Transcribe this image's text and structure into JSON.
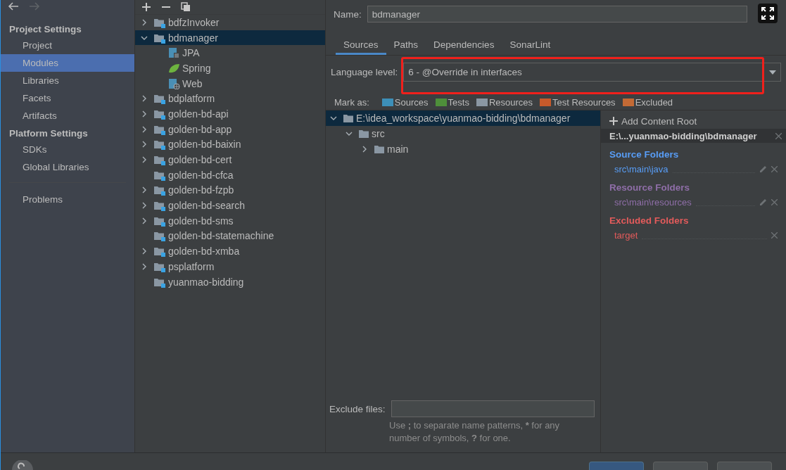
{
  "sidebar": {
    "groups": [
      {
        "title": "Project Settings",
        "items": [
          {
            "label": "Project",
            "selected": false
          },
          {
            "label": "Modules",
            "selected": true
          },
          {
            "label": "Libraries",
            "selected": false
          },
          {
            "label": "Facets",
            "selected": false
          },
          {
            "label": "Artifacts",
            "selected": false
          }
        ]
      },
      {
        "title": "Platform Settings",
        "items": [
          {
            "label": "SDKs",
            "selected": false
          },
          {
            "label": "Global Libraries",
            "selected": false
          }
        ]
      }
    ],
    "footer_items": [
      {
        "label": "Problems",
        "selected": false
      }
    ]
  },
  "modules": [
    {
      "label": "bdfzInvoker",
      "expandable": true,
      "expanded": false,
      "selected": false
    },
    {
      "label": "bdmanager",
      "expandable": true,
      "expanded": true,
      "selected": true,
      "children": [
        {
          "label": "JPA",
          "kind": "jpa"
        },
        {
          "label": "Spring",
          "kind": "spring"
        },
        {
          "label": "Web",
          "kind": "web"
        }
      ]
    },
    {
      "label": "bdplatform",
      "expandable": true,
      "expanded": false,
      "selected": false
    },
    {
      "label": "golden-bd-api",
      "expandable": true,
      "expanded": false,
      "selected": false
    },
    {
      "label": "golden-bd-app",
      "expandable": true,
      "expanded": false,
      "selected": false
    },
    {
      "label": "golden-bd-baixin",
      "expandable": true,
      "expanded": false,
      "selected": false
    },
    {
      "label": "golden-bd-cert",
      "expandable": true,
      "expanded": false,
      "selected": false
    },
    {
      "label": "golden-bd-cfca",
      "expandable": false,
      "expanded": false,
      "selected": false
    },
    {
      "label": "golden-bd-fzpb",
      "expandable": true,
      "expanded": false,
      "selected": false
    },
    {
      "label": "golden-bd-search",
      "expandable": true,
      "expanded": false,
      "selected": false
    },
    {
      "label": "golden-bd-sms",
      "expandable": true,
      "expanded": false,
      "selected": false
    },
    {
      "label": "golden-bd-statemachine",
      "expandable": false,
      "expanded": false,
      "selected": false
    },
    {
      "label": "golden-bd-xmba",
      "expandable": true,
      "expanded": false,
      "selected": false
    },
    {
      "label": "psplatform",
      "expandable": true,
      "expanded": false,
      "selected": false
    },
    {
      "label": "yuanmao-bidding",
      "expandable": false,
      "expanded": false,
      "selected": false
    }
  ],
  "name_field": {
    "label": "Name:",
    "value": "bdmanager"
  },
  "tabs": [
    {
      "label": "Sources",
      "selected": true
    },
    {
      "label": "Paths",
      "selected": false
    },
    {
      "label": "Dependencies",
      "selected": false
    },
    {
      "label": "SonarLint",
      "selected": false
    }
  ],
  "language_level": {
    "label": "Language level:",
    "value": "6 - @Override in interfaces"
  },
  "mark_as": {
    "label": "Mark as:",
    "options": [
      {
        "label": "Sources",
        "color": "#3d8fb8"
      },
      {
        "label": "Tests",
        "color": "#4e8f3a"
      },
      {
        "label": "Resources",
        "color": "#8a97a3"
      },
      {
        "label": "Test Resources",
        "color": "#c75a2b"
      },
      {
        "label": "Excluded",
        "color": "#c36a35"
      }
    ]
  },
  "content_tree": [
    {
      "label": "E:\\idea_workspace\\yuanmao-bidding\\bdmanager",
      "expanded": true,
      "selected": true,
      "children": [
        {
          "label": "src",
          "expanded": true,
          "selected": false,
          "children": [
            {
              "label": "main",
              "expanded": false,
              "selected": false
            }
          ]
        }
      ]
    }
  ],
  "content_root": {
    "add_label": "Add Content Root",
    "path": "E:\\...yuanmao-bidding\\bdmanager",
    "sections": [
      {
        "title": "Source Folders",
        "color": "#589df6",
        "folders": [
          {
            "path": "src\\main\\java",
            "editable": true
          }
        ]
      },
      {
        "title": "Resource Folders",
        "color": "#8f6ea8",
        "folders": [
          {
            "path": "src\\main\\resources",
            "editable": true
          }
        ]
      },
      {
        "title": "Excluded Folders",
        "color": "#e35b5b",
        "folders": [
          {
            "path": "target",
            "editable": false
          }
        ]
      }
    ]
  },
  "exclude_files": {
    "label": "Exclude files:",
    "hint": [
      {
        "text": "Use ",
        "bold": false
      },
      {
        "text": ";",
        "bold": true
      },
      {
        "text": " to separate name patterns, ",
        "bold": false
      },
      {
        "text": "*",
        "bold": true
      },
      {
        "text": " for any number of symbols, ",
        "bold": false
      },
      {
        "text": "?",
        "bold": true
      },
      {
        "text": " for one.",
        "bold": false
      }
    ]
  },
  "buttons": [
    {
      "default": true
    },
    {
      "default": false
    },
    {
      "default": false
    }
  ],
  "highlight": {
    "kind": "rectangle"
  }
}
